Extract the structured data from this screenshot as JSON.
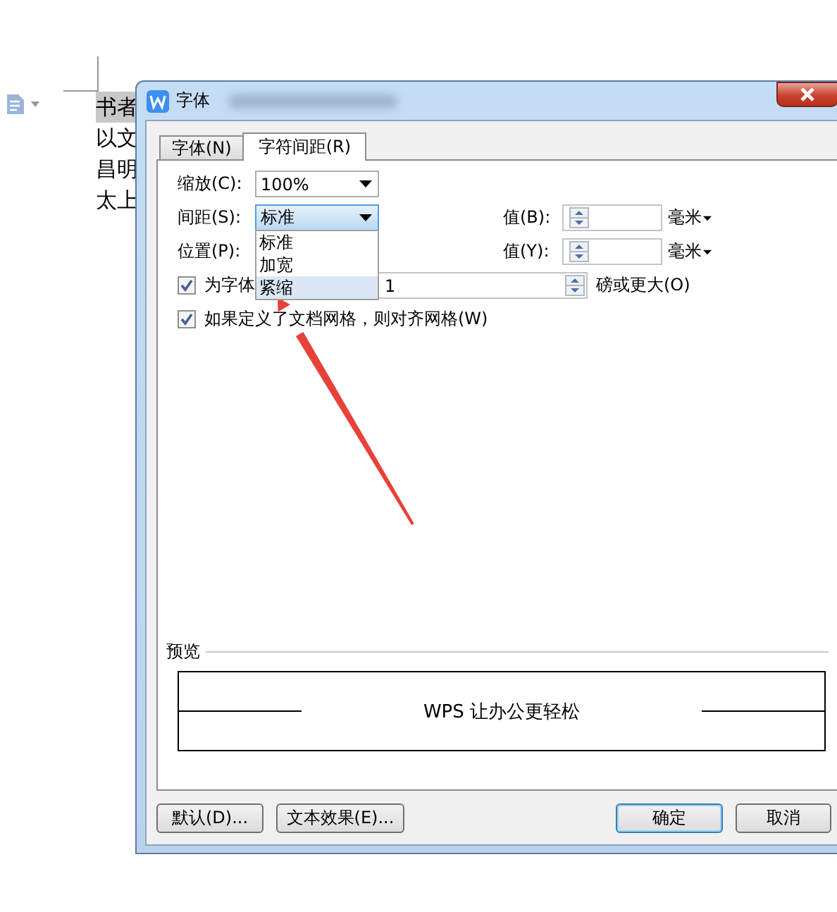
{
  "document": {
    "lines": [
      {
        "text": "书者",
        "selected": true
      },
      {
        "text": "以文",
        "selected": false
      },
      {
        "text": "昌明",
        "selected": false
      },
      {
        "text": "太上",
        "selected": false
      }
    ]
  },
  "dialog": {
    "title": "字体",
    "tabs": [
      {
        "label": "字体(N)",
        "selected": false
      },
      {
        "label": "字符间距(R)",
        "selected": true
      }
    ],
    "scale": {
      "label": "缩放(C):",
      "value": "100%"
    },
    "spacing": {
      "label": "间距(S):",
      "value": "标准",
      "expanded": true,
      "options": [
        {
          "label": "标准",
          "highlighted": false
        },
        {
          "label": "加宽",
          "highlighted": false
        },
        {
          "label": "紧缩",
          "highlighted": true
        }
      ]
    },
    "spacing_value": {
      "label": "值(B):",
      "unit": "毫米"
    },
    "position": {
      "label": "位置(P):"
    },
    "position_value": {
      "label": "值(Y):",
      "unit": "毫米"
    },
    "kerning": {
      "label": "为字体",
      "checked": true,
      "value": "1",
      "suffix": "磅或更大(O)"
    },
    "snap_to_grid": {
      "label": "如果定义了文档网格，则对齐网格(W)",
      "checked": true
    },
    "preview": {
      "label": "预览",
      "text": "WPS 让办公更轻松"
    },
    "buttons": [
      {
        "label": "默认(D)...",
        "default": false
      },
      {
        "label": "文本效果(E)...",
        "default": false
      },
      {
        "label": "确定",
        "default": true
      },
      {
        "label": "取消",
        "default": false
      }
    ]
  }
}
